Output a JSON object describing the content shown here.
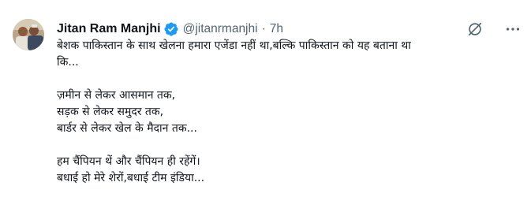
{
  "author": {
    "display_name": "Jitan Ram Manjhi",
    "handle": "@jitanrmanjhi",
    "separator": "·",
    "time": "7h",
    "verified": true
  },
  "icons": {
    "verified": "verified-badge-icon",
    "grok": "grok-icon",
    "more": "more-options-icon"
  },
  "colors": {
    "verified_blue": "#1d9bf0",
    "text": "#0f1419",
    "secondary": "#536471"
  },
  "tweet": {
    "lines": [
      "बेशक पाकिस्तान के साथ खेलना हमारा एजेंडा नहीं था,बल्कि पाकिस्तान को यह बताना था",
      "कि...",
      "",
      "ज़मीन से लेकर आसमान तक,",
      "सड़क से लेकर समुदर तक,",
      "बार्डर से लेकर खेल के मैदान तक...",
      "",
      "हम चैंपियन थें और चैंपियन ही रहेंगें।",
      "बधाई हो मेरे शेरों,बधाई टीम इंडिया..."
    ]
  }
}
